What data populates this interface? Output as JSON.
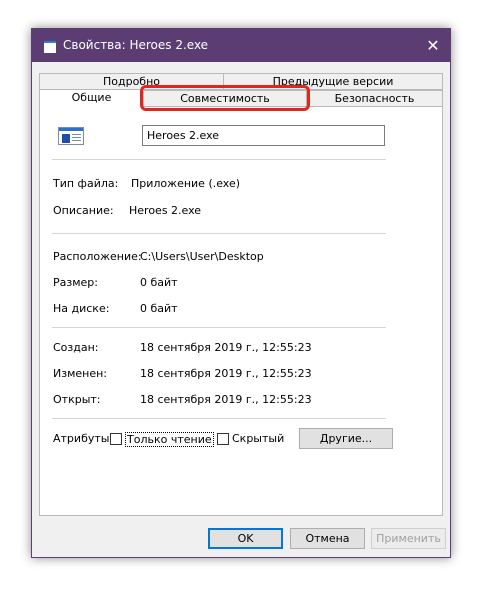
{
  "window": {
    "title": "Свойства: Heroes 2.exe",
    "close_glyph": "✕"
  },
  "tabs": {
    "back_row": [
      {
        "label": "Подробно"
      },
      {
        "label": "Предыдущие версии"
      }
    ],
    "front_row": [
      {
        "label": "Общие",
        "active": true
      },
      {
        "label": "Совместимость",
        "highlighted": true
      },
      {
        "label": "Безопасность"
      }
    ]
  },
  "general": {
    "file_name": "Heroes 2.exe",
    "file_type_label": "Тип файла:",
    "file_type_value": "Приложение (.exe)",
    "description_label": "Описание:",
    "description_value": "Heroes 2.exe",
    "location_label": "Расположение:",
    "location_value": "C:\\Users\\User\\Desktop",
    "size_label": "Размер:",
    "size_value": "0 байт",
    "disk_label": "На диске:",
    "disk_value": "0 байт",
    "created_label": "Создан:",
    "created_value": "18 сентября 2019 г., 12:55:23",
    "modified_label": "Изменен:",
    "modified_value": "18 сентября 2019 г., 12:55:23",
    "opened_label": "Открыт:",
    "opened_value": "18 сентября 2019 г., 12:55:23",
    "attributes_label": "Атрибуты:",
    "readonly_label": "Только чтение",
    "hidden_label": "Скрытый",
    "other_button": "Другие..."
  },
  "footer": {
    "ok": "OK",
    "cancel": "Отмена",
    "apply": "Применить"
  },
  "colors": {
    "titlebar": "#5b3d74",
    "highlight": "#e0261d",
    "focus": "#0078d7"
  }
}
